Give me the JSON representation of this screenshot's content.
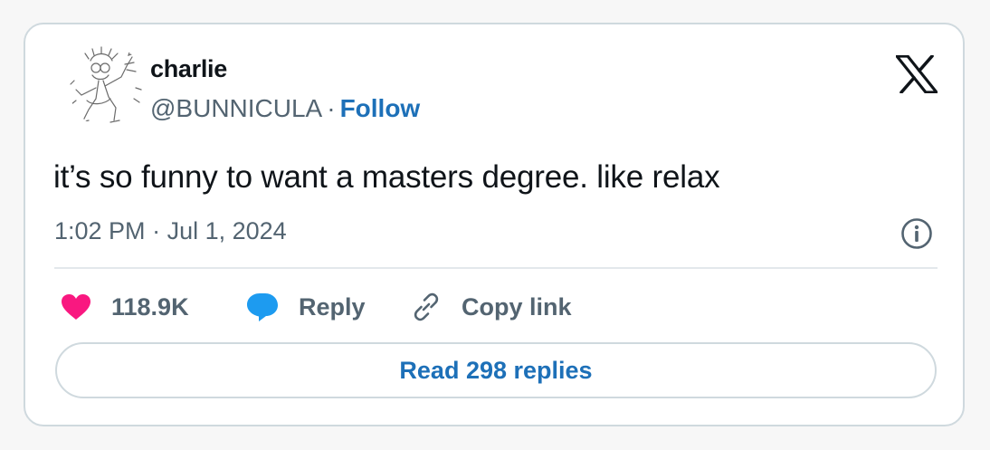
{
  "author": {
    "display_name": "charlie",
    "handle": "@BUNNICULA",
    "separator": "·",
    "follow_label": "Follow"
  },
  "tweet": {
    "text": "it’s so funny to want a masters degree. like relax",
    "time": "1:02 PM",
    "separator": "·",
    "date": "Jul 1, 2024"
  },
  "actions": {
    "like_count": "118.9K",
    "reply_label": "Reply",
    "copy_link_label": "Copy link",
    "read_replies_label": "Read 298 replies"
  },
  "icons": {
    "avatar": "sketch-drawing-avatar",
    "brand": "x-logo-icon",
    "info": "info-icon",
    "like": "heart-icon",
    "reply": "speech-bubble-icon",
    "copy": "link-icon"
  },
  "colors": {
    "like_heart": "#f91880",
    "reply_bubble": "#1d9bf0",
    "link_accent": "#1d70b8",
    "muted_text": "#536471",
    "border": "#cfd9de"
  }
}
